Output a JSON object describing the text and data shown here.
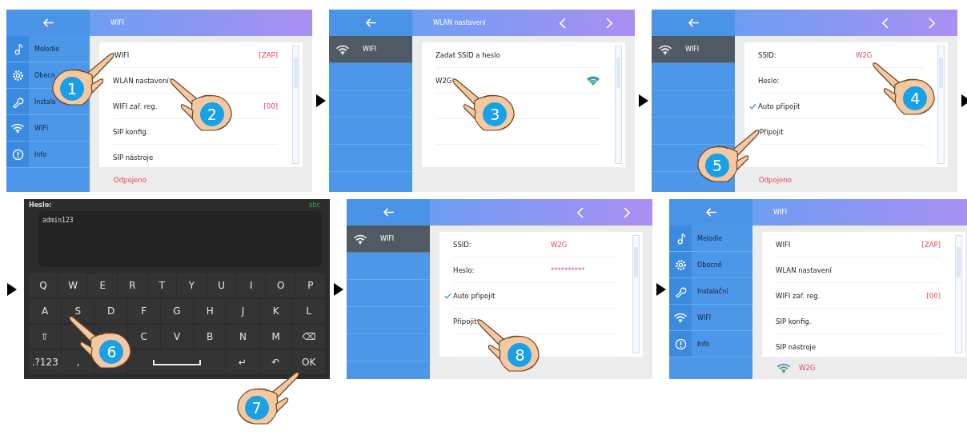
{
  "strips": [
    {
      "panels": [
        {
          "kind": "menu",
          "title": "WIFI",
          "nav": false,
          "sidebar": [
            {
              "label": "Melodie",
              "selected": false
            },
            {
              "label": "Obecn",
              "selected": false
            },
            {
              "label": "Instala",
              "selected": false
            },
            {
              "label": "WIFI",
              "selected": false
            },
            {
              "label": "Info",
              "selected": false
            }
          ],
          "items": [
            {
              "label": "WIFI",
              "value": "[ZAP]",
              "tap": {
                "step": "1",
                "kind": "left"
              }
            },
            {
              "label": "WLAN nastavení",
              "tap": {
                "step": "2",
                "kind": "right"
              }
            },
            {
              "label": "WIFI zař. reg.",
              "value": "[00]"
            },
            {
              "label": "SIP konfig."
            },
            {
              "label": "SIP nástroje"
            }
          ],
          "footer": {
            "text": "Odpojeno"
          }
        },
        {
          "kind": "networks",
          "title": "WLAN nastavení",
          "nav": true,
          "sidebar": [
            {
              "label": "WIFI",
              "selected": true
            }
          ],
          "items": [
            {
              "label": "Zadat SSID a heslo"
            },
            {
              "label": "W2G",
              "signal": true,
              "tap": {
                "step": "3",
                "kind": "right"
              }
            }
          ]
        },
        {
          "kind": "form",
          "nav": true,
          "sidebar": [
            {
              "label": "WIFI",
              "selected": true
            }
          ],
          "items": [
            {
              "label": "SSID:",
              "value": "W2G",
              "tap": {
                "step": "4",
                "kind": "right"
              }
            },
            {
              "label": "Heslo:"
            },
            {
              "label": "Auto připojit",
              "checked": true
            },
            {
              "label": "Připojit",
              "tap": {
                "step": "5",
                "kind": "left"
              }
            }
          ],
          "footer": {
            "text": "Odpojeno"
          }
        }
      ]
    },
    {
      "panels": [
        {
          "kind": "keyboard",
          "label": "Heslo:",
          "mode": "abc",
          "value": "admin123",
          "keys": [
            [
              {
                "kind": "char",
                "label": "Q"
              },
              {
                "kind": "char",
                "label": "W"
              },
              {
                "kind": "char",
                "label": "E"
              },
              {
                "kind": "char",
                "label": "R"
              },
              {
                "kind": "char",
                "label": "T"
              },
              {
                "kind": "char",
                "label": "Y"
              },
              {
                "kind": "char",
                "label": "U"
              },
              {
                "kind": "char",
                "label": "I"
              },
              {
                "kind": "char",
                "label": "O"
              },
              {
                "kind": "char",
                "label": "P"
              }
            ],
            [
              {
                "kind": "char",
                "label": "A"
              },
              {
                "kind": "char",
                "label": "S",
                "tap": {
                  "step": "6",
                  "kind": "right"
                }
              },
              {
                "kind": "char",
                "label": "D"
              },
              {
                "kind": "char",
                "label": "F"
              },
              {
                "kind": "char",
                "label": "G"
              },
              {
                "kind": "char",
                "label": "H"
              },
              {
                "kind": "char",
                "label": "J"
              },
              {
                "kind": "char",
                "label": "K"
              },
              {
                "kind": "char",
                "label": "L"
              }
            ],
            [
              {
                "kind": "char",
                "label": "⇧"
              },
              {
                "kind": "blank"
              },
              {
                "kind": "blank"
              },
              {
                "kind": "char",
                "label": "C"
              },
              {
                "kind": "char",
                "label": "V"
              },
              {
                "kind": "char",
                "label": "B"
              },
              {
                "kind": "char",
                "label": "N"
              },
              {
                "kind": "char",
                "label": "M"
              },
              {
                "kind": "char",
                "label": "⌫"
              }
            ],
            [
              {
                "kind": "char",
                "label": ".?123"
              },
              {
                "kind": "char",
                "label": ","
              },
              {
                "kind": "blank"
              },
              {
                "kind": "space"
              },
              {
                "kind": "char",
                "label": "↵"
              },
              {
                "kind": "char",
                "label": "↶"
              },
              {
                "kind": "char",
                "label": "OK",
                "tap": {
                  "step": "7",
                  "kind": "left"
                }
              }
            ]
          ]
        },
        {
          "kind": "form",
          "nav": true,
          "sidebar": [
            {
              "label": "WIFI",
              "selected": true
            }
          ],
          "items": [
            {
              "label": "SSID:",
              "value": "W2G"
            },
            {
              "label": "Heslo:",
              "value": "**********"
            },
            {
              "label": "Auto připojit",
              "checked": true
            },
            {
              "label": "Připojit",
              "tap": {
                "step": "8",
                "kind": "right"
              }
            }
          ]
        },
        {
          "kind": "menu",
          "title": "WIFI",
          "nav": false,
          "sidebar": [
            {
              "label": "Melodie",
              "selected": false
            },
            {
              "label": "Obecné",
              "selected": false
            },
            {
              "label": "Instalační",
              "selected": false
            },
            {
              "label": "WIFI",
              "selected": false
            },
            {
              "label": "Info",
              "selected": false
            }
          ],
          "items": [
            {
              "label": "WIFI",
              "value": "[ZAP]"
            },
            {
              "label": "WLAN nastavení"
            },
            {
              "label": "WIFI zař. reg.",
              "value": "[00]"
            },
            {
              "label": "SIP konfig."
            },
            {
              "label": "SIP nástroje"
            }
          ],
          "footer": {
            "text": "W2G",
            "signal": true
          }
        }
      ]
    }
  ]
}
